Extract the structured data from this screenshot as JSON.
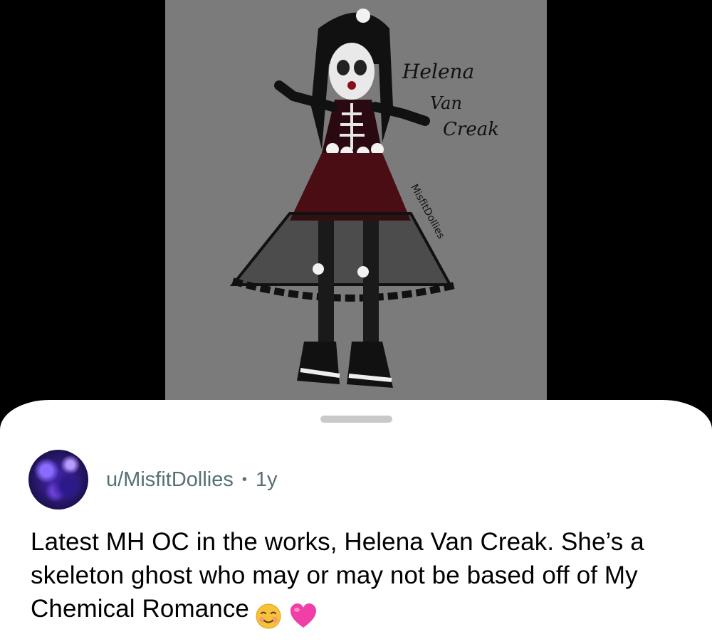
{
  "artwork": {
    "caption_lines": [
      "Helena",
      "Van",
      "Creak"
    ],
    "signature": "MisfitDollies",
    "background": "#7b7b7b"
  },
  "post": {
    "username": "u/MisfitDollies",
    "separator": "•",
    "age": "1y",
    "text": "Latest MH OC in the works, Helena Van Creak. She’s a skeleton ghost who may or may not be based off of My Chemical Romance",
    "emojis": [
      "smiling-face-emoji",
      "pink-heart-emoji"
    ]
  },
  "colors": {
    "username": "#576f76",
    "body_text": "#000000",
    "sheet": "#ffffff",
    "grabber": "#c9c9cc"
  }
}
